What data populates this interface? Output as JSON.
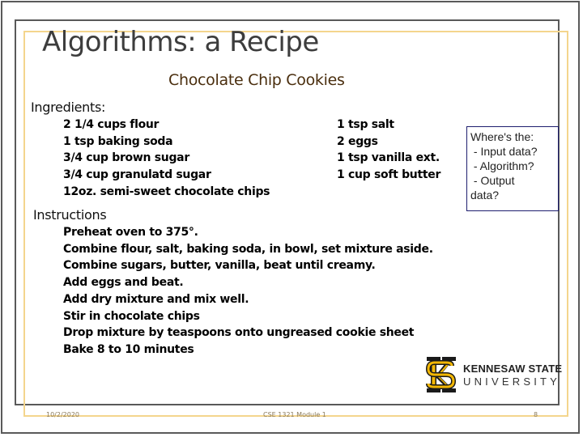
{
  "slide": {
    "title": "Algorithms: a Recipe",
    "subtitle": "Chocolate Chip Cookies",
    "ingredients": {
      "label": "Ingredients:",
      "column1": [
        "2 1/4 cups flour",
        "1 tsp baking soda",
        "3/4 cup brown sugar",
        "3/4 cup granulatd sugar",
        "12oz. semi-sweet chocolate chips"
      ],
      "column2": [
        "1 tsp salt",
        "2 eggs",
        "1 tsp vanilla ext.",
        "1 cup soft butter"
      ]
    },
    "instructions": {
      "label": "Instructions",
      "steps": [
        "Preheat oven to 375°.",
        "Combine flour, salt, baking soda, in bowl, set mixture aside.",
        "Combine sugars, butter, vanilla, beat until creamy.",
        "Add eggs and beat.",
        "Add dry mixture and mix well.",
        "Stir in chocolate chips",
        "Drop mixture by teaspoons onto ungreased cookie sheet",
        "Bake 8 to 10 minutes"
      ]
    },
    "callout": {
      "text": "Where's the:\n - Input data?\n - Algorithm?\n - Output\ndata?"
    },
    "logo": {
      "line1": "KENNESAW STATE",
      "line2": "UNIVERSITY",
      "icon": "ksu-monogram-icon"
    },
    "footer": {
      "date": "10/2/2020",
      "course": "CSE 1321 Module 1",
      "page_number": "8"
    }
  },
  "colors": {
    "subtitle": "#4a2e0e",
    "accent_frame": "#f4d58d",
    "callout_border": "#1e1e6e",
    "logo_gold": "#f2b705"
  }
}
